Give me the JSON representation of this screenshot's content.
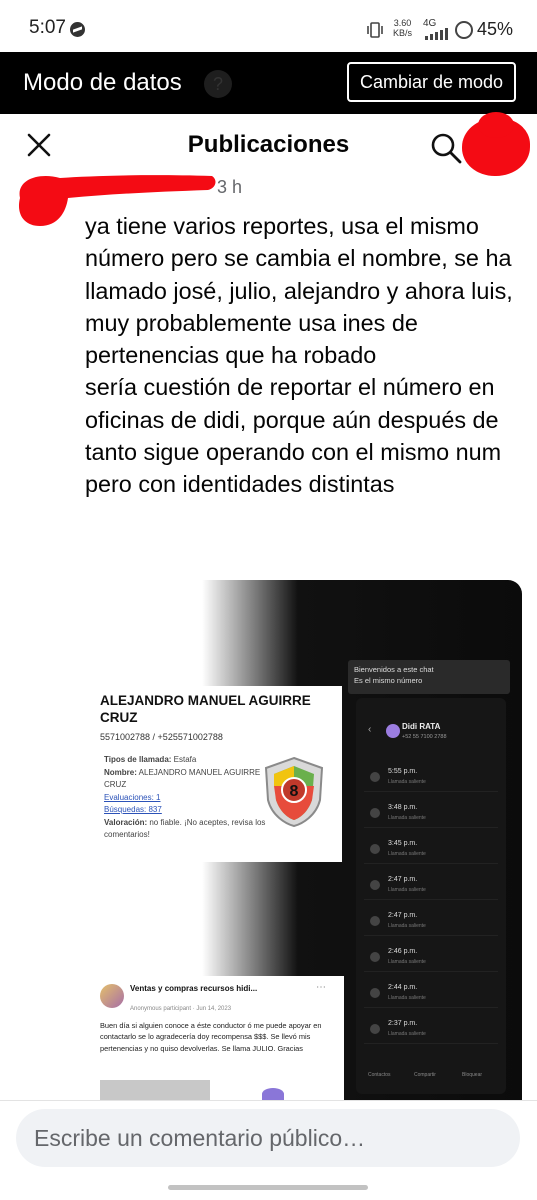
{
  "status_bar": {
    "time": "5:07",
    "net_speed_value": "3.60",
    "net_speed_unit": "KB/s",
    "network": "4G",
    "battery": "45%"
  },
  "data_banner": {
    "title": "Modo de datos",
    "help_icon": "?",
    "switch_button": "Cambiar de modo"
  },
  "header": {
    "title": "Publicaciones"
  },
  "post": {
    "time": "3 h",
    "body": "ya tiene varios reportes, usa el mismo número pero se cambia el nombre, se ha llamado josé, julio, alejandro y ahora luis, muy probablemente usa ines de pertenencias que ha robado\nsería cuestión de reportar el número en oficinas de didi, porque aún después de tanto sigue operando con el mismo num pero con identidades distintas"
  },
  "attachment": {
    "card": {
      "name": "ALEJANDRO MANUEL AGUIRRE CRUZ",
      "phones": "5571002788 / +525571002788",
      "call_type_label": "Tipos de llamada:",
      "call_type": "Estafa",
      "name_label": "Nombre:",
      "name_value": "ALEJANDRO MANUEL AGUIRRE CRUZ",
      "ratings": "Evaluaciones: 1",
      "searches": "Búsquedas: 837",
      "valuation_label": "Valoración:",
      "valuation": "no fiable. ¡No aceptes, revisa los comentarios!",
      "score": "8"
    },
    "chat_bubble": {
      "header": "Bienvenidos a este chat",
      "text": "Es el mismo número"
    },
    "phone": {
      "contact": "Didi RATA",
      "contact_number": "+52 55 7100 2788",
      "calls": [
        {
          "time": "5:55 p.m.",
          "type": "Llamada saliente"
        },
        {
          "time": "3:48 p.m.",
          "type": "Llamada saliente"
        },
        {
          "time": "3:45 p.m.",
          "type": "Llamada saliente"
        },
        {
          "time": "2:47 p.m.",
          "type": "Llamada saliente"
        },
        {
          "time": "2:47 p.m.",
          "type": "Llamada saliente"
        },
        {
          "time": "2:46 p.m.",
          "type": "Llamada saliente"
        },
        {
          "time": "2:44 p.m.",
          "type": "Llamada saliente"
        },
        {
          "time": "2:37 p.m.",
          "type": "Llamada saliente"
        }
      ],
      "nav": [
        "Contactos",
        "Compartir",
        "Bloquear"
      ]
    },
    "fb_post": {
      "group": "Ventas y compras recursos hidi...",
      "meta": "Anonymous participant · Jun 14, 2023",
      "text": "Buen día si alguien conoce a éste conductor ó me puede apoyar en contactarlo se lo agradecería doy recompensa $$$. Se llevó mis pertenencias y no quiso devolverlas. Se llama JULIO. Gracias"
    }
  },
  "comment": {
    "placeholder": "Escribe un comentario público…"
  },
  "colors": {
    "banner_bg": "#000000",
    "redaction": "#f40b14",
    "input_bg": "#f0f2f5",
    "secondary_text": "#65676b"
  }
}
